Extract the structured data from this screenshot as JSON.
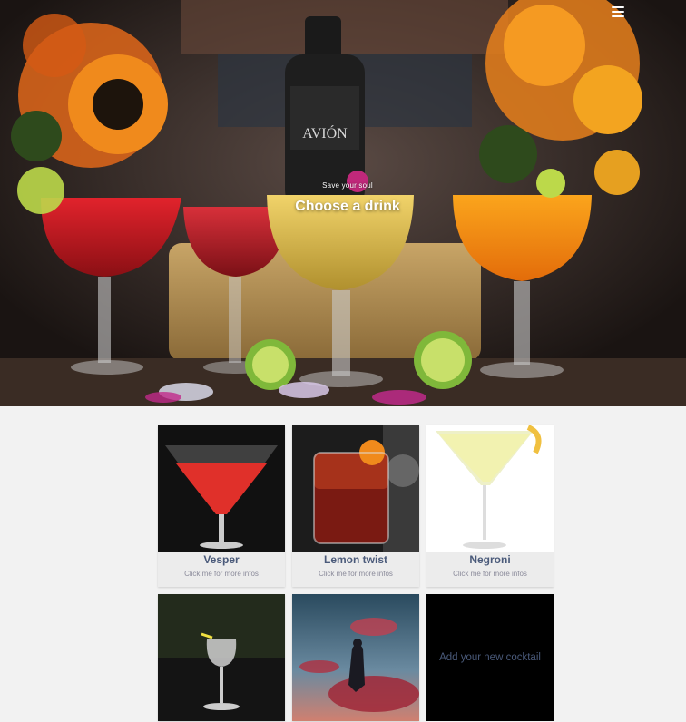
{
  "hero": {
    "subtitle": "Save your soul",
    "title": "Choose a drink",
    "bottle_label": "AVIÓN",
    "menu_icon": "hamburger-menu-icon"
  },
  "cocktails": [
    {
      "name": "Vesper",
      "hint": "Click me for more infos",
      "image": "red-martini-photo"
    },
    {
      "name": "Lemon twist",
      "hint": "Click me for more infos",
      "image": "negroni-rocks-glass-photo"
    },
    {
      "name": "Negroni",
      "hint": "Click me for more infos",
      "image": "yellow-martini-photo"
    },
    {
      "image": "coupe-glass-photo"
    },
    {
      "image": "silhouette-sunset-photo"
    }
  ],
  "add_card": {
    "label": "Add your new cocktail"
  },
  "colors": {
    "page_bg": "#f2f2f2",
    "card_name": "#4a5a7a",
    "card_hint": "#8a8a9a"
  }
}
